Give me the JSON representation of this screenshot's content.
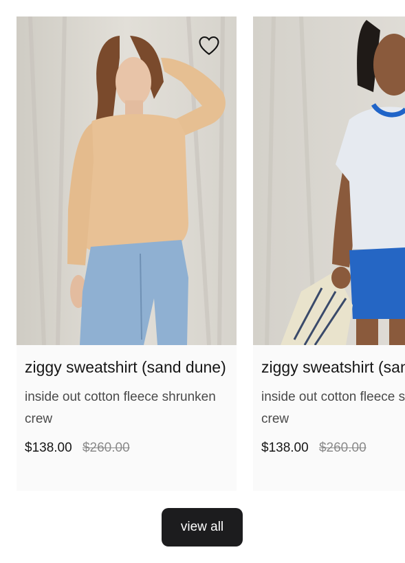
{
  "products": [
    {
      "name": "ziggy sweatshirt (sand dune)",
      "description": "inside out cotton fleece shrunken crew",
      "price": "$138.00",
      "compare_price": "$260.00"
    },
    {
      "name": "ziggy sweatshirt (sand dune)",
      "description": "inside out cotton fleece shrunken crew",
      "price": "$138.00",
      "compare_price": "$260.00"
    }
  ],
  "wishlist_icon": "heart-icon",
  "view_all_label": "view all",
  "colors": {
    "button_bg": "#1c1c1e",
    "button_text": "#ffffff",
    "compare_price": "#8a8a8a",
    "card_bg": "#fafafa"
  }
}
